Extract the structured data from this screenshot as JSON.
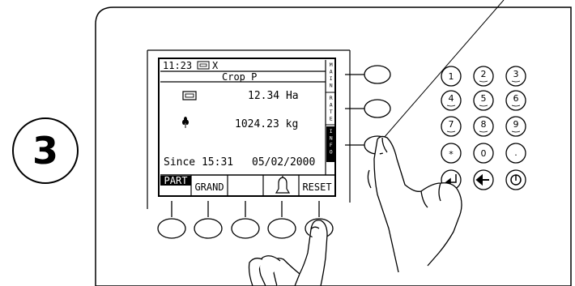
{
  "step": {
    "number": "3"
  },
  "display": {
    "time": "11:23",
    "status_suffix": "X",
    "crop": "Crop P",
    "area": "12.34 Ha",
    "weight": "1024.23 kg",
    "since_label": "Since 15:31",
    "since_date": "05/02/2000",
    "side_tabs": [
      "MAIN",
      "RATE",
      "INFO"
    ],
    "active_tab": "INFO"
  },
  "softkeys": {
    "part": "PART",
    "grand": "GRAND",
    "blank": "",
    "bell_icon": "bell-icon",
    "reset": "RESET",
    "active": "PART"
  },
  "keypad": {
    "digits": [
      "1",
      "2",
      "3",
      "4",
      "5",
      "6",
      "7",
      "8",
      "9"
    ],
    "star": "*",
    "zero": "0",
    "dot": "."
  },
  "colors": {
    "line": "#000000",
    "background": "#ffffff"
  }
}
